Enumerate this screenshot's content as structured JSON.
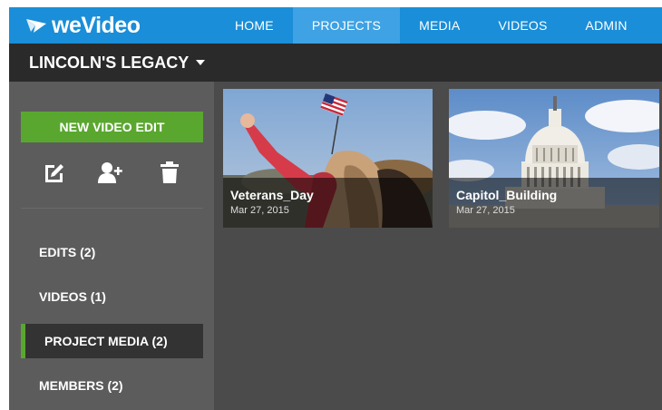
{
  "brand": {
    "name": "weVideo",
    "color": "#1a8ed8"
  },
  "nav": {
    "items": [
      {
        "label": "HOME",
        "active": false
      },
      {
        "label": "PROJECTS",
        "active": true
      },
      {
        "label": "MEDIA",
        "active": false
      },
      {
        "label": "VIDEOS",
        "active": false
      },
      {
        "label": "ADMIN",
        "active": false
      }
    ]
  },
  "project": {
    "title": "LINCOLN'S LEGACY"
  },
  "sidebar": {
    "new_button": "NEW VIDEO EDIT",
    "tools": [
      {
        "icon": "edit-icon"
      },
      {
        "icon": "add-member-icon"
      },
      {
        "icon": "trash-icon"
      }
    ],
    "items": [
      {
        "label": "EDITS (2)",
        "active": false
      },
      {
        "label": "VIDEOS (1)",
        "active": false
      },
      {
        "label": "PROJECT MEDIA (2)",
        "active": true
      },
      {
        "label": "MEMBERS (2)",
        "active": false
      }
    ]
  },
  "media": [
    {
      "name": "Veterans_Day",
      "date": "Mar 27, 2015"
    },
    {
      "name": "Capitol_Building",
      "date": "Mar 27, 2015"
    }
  ],
  "colors": {
    "accent_green": "#5aa72f",
    "nav_active": "#3ea2e4",
    "dark_bar": "#2a2a2a"
  }
}
